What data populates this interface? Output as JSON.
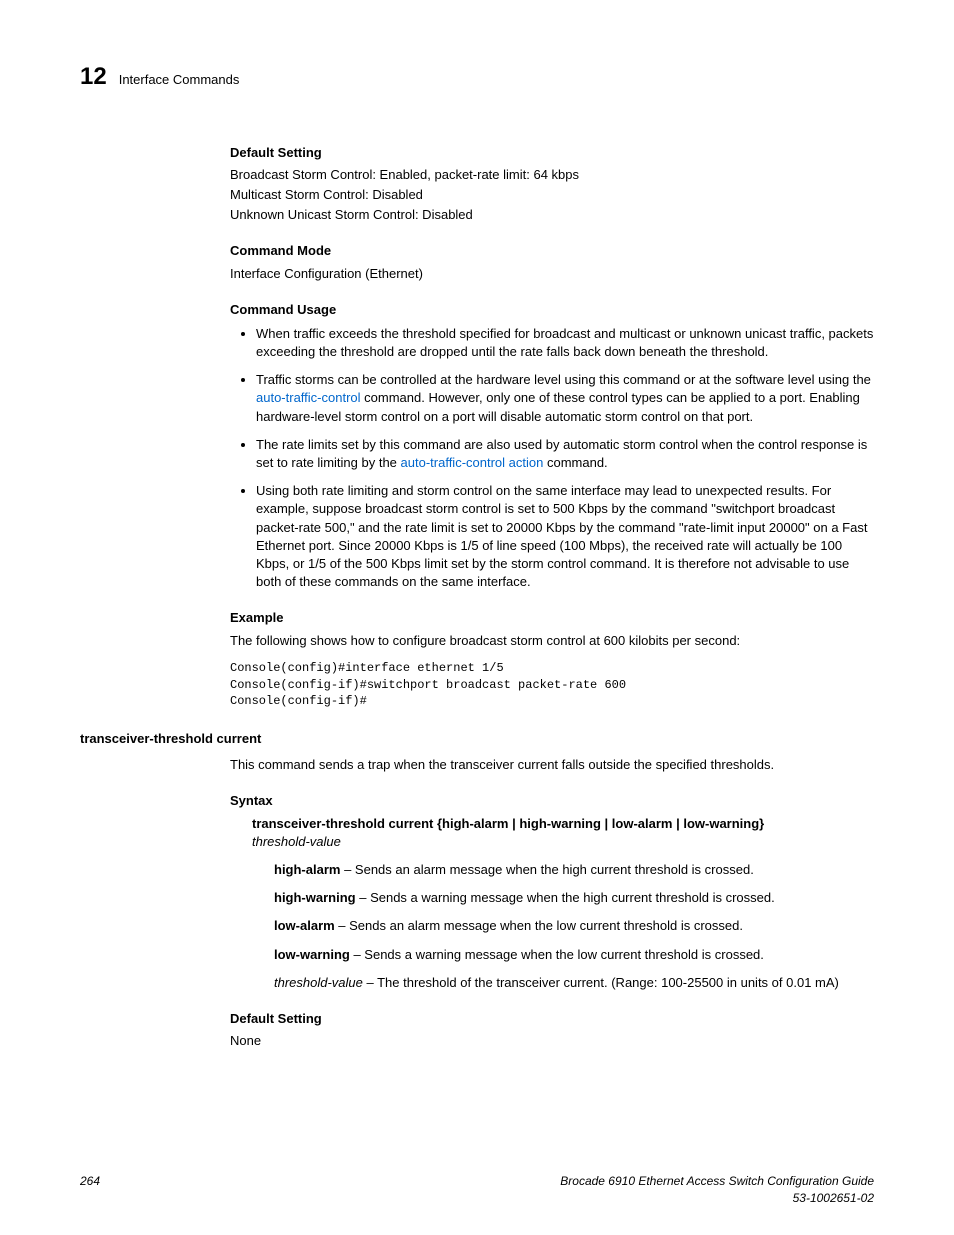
{
  "header": {
    "chapter_number": "12",
    "chapter_title": "Interface Commands"
  },
  "sections": {
    "default_setting_1": {
      "heading": "Default Setting",
      "line1": "Broadcast Storm Control: Enabled, packet-rate limit: 64 kbps",
      "line2": "Multicast Storm Control: Disabled",
      "line3": "Unknown Unicast Storm Control: Disabled"
    },
    "command_mode": {
      "heading": "Command Mode",
      "body": "Interface Configuration (Ethernet)"
    },
    "command_usage": {
      "heading": "Command Usage",
      "bullet1": "When traffic exceeds the threshold specified for broadcast and multicast or unknown unicast traffic, packets exceeding the threshold are dropped until the rate falls back down beneath the threshold.",
      "bullet2_a": "Traffic storms can be controlled at the hardware level using this command or at the software level using the ",
      "bullet2_link": "auto-traffic-control",
      "bullet2_b": " command. However, only one of these control types can be applied to a port. Enabling hardware-level storm control on a port will disable automatic storm control on that port.",
      "bullet3_a": "The rate limits set by this command are also used by automatic storm control when the control response is set to rate limiting by the ",
      "bullet3_link": "auto-traffic-control action",
      "bullet3_b": " command.",
      "bullet4": "Using both rate limiting and storm control on the same interface may lead to unexpected results. For example, suppose broadcast storm control is set to 500 Kbps by the command \"switchport broadcast packet-rate 500,\" and the rate limit is set to 20000 Kbps by the command \"rate-limit input 20000\" on a Fast Ethernet port. Since 20000 Kbps is 1/5 of line speed (100 Mbps), the received rate will actually be 100 Kbps, or 1/5 of the 500 Kbps limit set by the storm control command. It is therefore not advisable to use both of these commands on the same interface."
    },
    "example": {
      "heading": "Example",
      "intro": "The following shows how to configure broadcast storm control at 600 kilobits per second:",
      "code": "Console(config)#interface ethernet 1/5\nConsole(config-if)#switchport broadcast packet-rate 600\nConsole(config-if)#"
    },
    "transceiver": {
      "heading": "transceiver-threshold current",
      "intro": "This command sends a trap when the transceiver current falls outside the specified thresholds.",
      "syntax_heading": "Syntax",
      "syntax_cmd_bold": "transceiver-threshold current",
      "syntax_cmd_rest": " {high-alarm | high-warning | low-alarm | low-warning}",
      "syntax_param": "threshold-value",
      "high_alarm_bold": "high-alarm",
      "high_alarm_text": " – Sends an alarm message when the high current threshold is crossed.",
      "high_warning_bold": "high-warning",
      "high_warning_text": " – Sends a warning message when the high current threshold is crossed.",
      "low_alarm_bold": "low-alarm",
      "low_alarm_text": " – Sends an alarm message when the low current threshold is crossed.",
      "low_warning_bold": "low-warning",
      "low_warning_text": " – Sends a warning message when the low current threshold is crossed.",
      "threshold_italic": "threshold-value",
      "threshold_text": " – The threshold of the transceiver current. (Range: 100-25500 in units of 0.01 mA)",
      "default_heading": "Default Setting",
      "default_body": "None"
    }
  },
  "footer": {
    "page_num": "264",
    "doc_title": "Brocade 6910 Ethernet Access Switch Configuration Guide",
    "doc_num": "53-1002651-02"
  }
}
